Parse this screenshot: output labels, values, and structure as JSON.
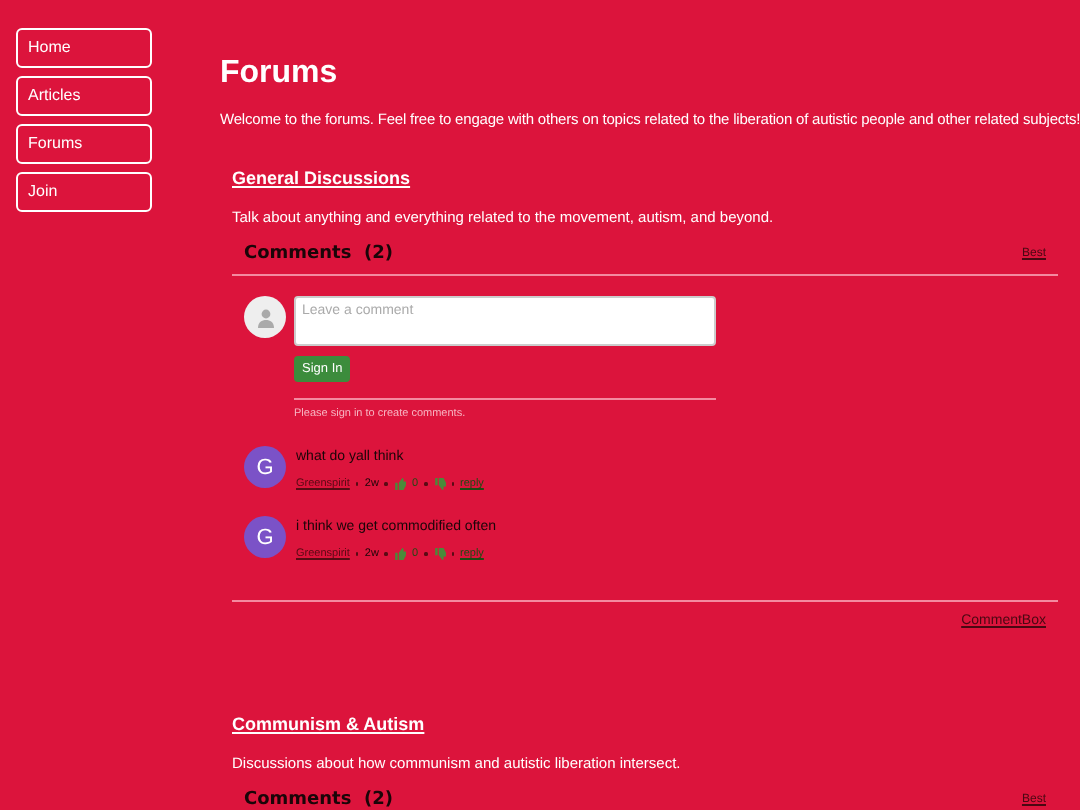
{
  "nav": [
    {
      "label": "Home"
    },
    {
      "label": "Articles"
    },
    {
      "label": "Forums"
    },
    {
      "label": "Join"
    }
  ],
  "title": "Forums",
  "intro": "Welcome to the forums. Feel free to engage with others on topics related to the liberation of autistic people and other related subjects!",
  "topics": [
    {
      "title": "General Discussions",
      "description": "Talk about anything and everything related to the movement, autism, and beyond.",
      "comments_label": "Comments",
      "comments_count": "(2)",
      "sort": "Best",
      "composer": {
        "placeholder": "Leave a comment",
        "button": "Sign In",
        "note": "Please sign in to create comments."
      },
      "comments": [
        {
          "avatar": "G",
          "text": "what do yall think",
          "author": "Greenspirit",
          "age": "2w",
          "likes": "0",
          "reply": "reply"
        },
        {
          "avatar": "G",
          "text": "i think we get commodified often",
          "author": "Greenspirit",
          "age": "2w",
          "likes": "0",
          "reply": "reply"
        }
      ],
      "footer": "CommentBox"
    },
    {
      "title": "Communism & Autism",
      "description": "Discussions about how communism and autistic liberation intersect.",
      "comments_label": "Comments",
      "comments_count": "(2)",
      "sort": "Best"
    }
  ]
}
